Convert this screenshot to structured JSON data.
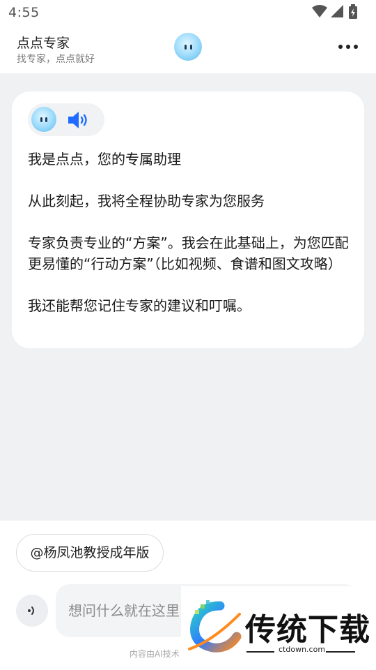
{
  "status_bar": {
    "time": "4:55"
  },
  "header": {
    "title": "点点专家",
    "subtitle": "找专家，点点就好"
  },
  "message": {
    "paragraphs": [
      "我是点点，您的专属助理",
      "从此刻起，我将全程协助专家为您服务",
      "专家负责专业的“方案”。我会在此基础上，为您匹配更易懂的“行动方案”（比如视频、食谱和图文攻略）",
      "我还能帮您记住专家的建议和叮嘱。"
    ]
  },
  "mention_chip": {
    "label": "@杨凤池教授成年版"
  },
  "input": {
    "placeholder": "想问什么就在这里"
  },
  "disclaimer": "内容由AI技术",
  "watermark": {
    "title": "传统下载",
    "url": "ctdown.com"
  },
  "colors": {
    "accent": "#1f6bff",
    "avatar": "#7fcdf6",
    "background": "#f0f1f3"
  }
}
